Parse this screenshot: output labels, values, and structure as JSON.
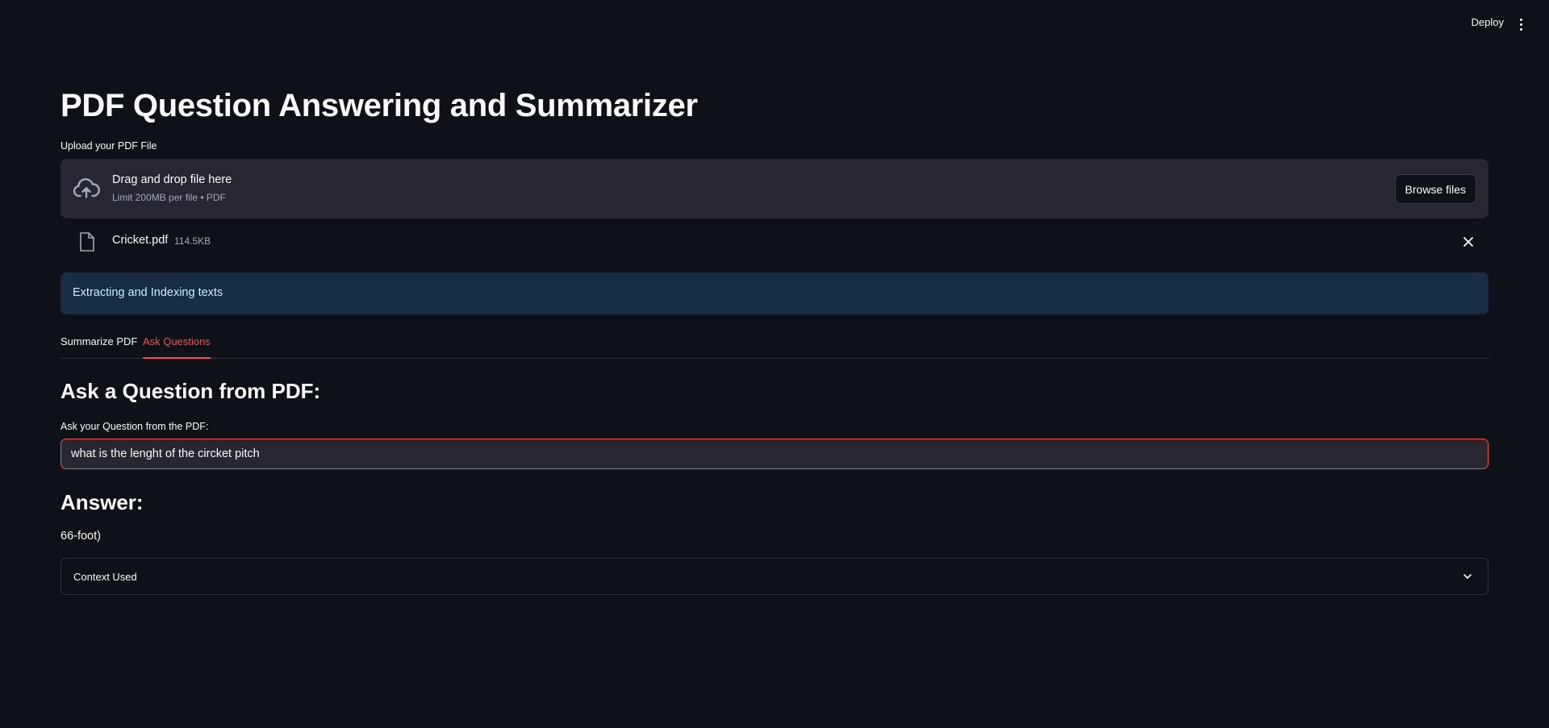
{
  "header": {
    "deploy_label": "Deploy",
    "menu_icon": "more-vertical-icon"
  },
  "page": {
    "title": "PDF Question Answering and Summarizer"
  },
  "uploader": {
    "label": "Upload your PDF File",
    "drop_title": "Drag and drop file here",
    "drop_limit": "Limit 200MB per file • PDF",
    "browse_label": "Browse files",
    "icon": "cloud-upload-icon"
  },
  "uploaded_file": {
    "name": "Cricket.pdf",
    "size": "114.5KB",
    "icon": "file-icon"
  },
  "info": {
    "message": "Extracting and Indexing texts",
    "color": "#172d43"
  },
  "tabs": [
    {
      "label": "Summarize PDF",
      "active": false
    },
    {
      "label": "Ask Questions",
      "active": true
    }
  ],
  "question": {
    "heading": "Ask a Question from PDF:",
    "input_label": "Ask your Question from the PDF:",
    "value": "what is the lenght of the circket pitch"
  },
  "answer": {
    "heading": "Answer:",
    "text": "66-foot)"
  },
  "expander": {
    "label": "Context Used",
    "expanded": false
  },
  "colors": {
    "background": "#0e1117",
    "accent": "#ff4b4b",
    "surface": "#262730"
  }
}
